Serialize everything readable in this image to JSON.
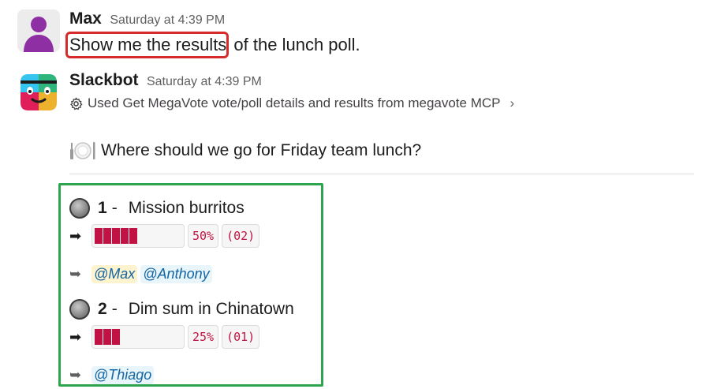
{
  "messages": [
    {
      "author": "Max",
      "time": "Saturday at 4:39 PM",
      "text_highlighted": "Show me the results",
      "text_rest": " of the lunch poll."
    },
    {
      "author": "Slackbot",
      "time": "Saturday at 4:39 PM",
      "tool_call": "Used Get MegaVote vote/poll details and results from megavote MCP",
      "tool_chevron": "›"
    }
  ],
  "poll": {
    "title": "Where should we go for Friday team lunch?",
    "title_icon": "plate-icon",
    "options": [
      {
        "number": "1",
        "dash": "-",
        "label": "Mission burritos",
        "percent": "50%",
        "percent_value": 50,
        "votes": "(02)",
        "voters": [
          "@Max",
          "@Anthony"
        ]
      },
      {
        "number": "2",
        "dash": "-",
        "label": "Dim sum in Chinatown",
        "percent": "25%",
        "percent_value": 25,
        "votes": "(01)",
        "voters": [
          "@Thiago"
        ]
      }
    ]
  },
  "colors": {
    "accent_red": "#c01343",
    "highlight_red_box": "#d62b2b",
    "highlight_green_box": "#2ea44f",
    "mention_blue": "#1264a3"
  },
  "icons": {
    "arrow": "➡",
    "voters_arrow": "➥",
    "gear": "gear-icon"
  }
}
